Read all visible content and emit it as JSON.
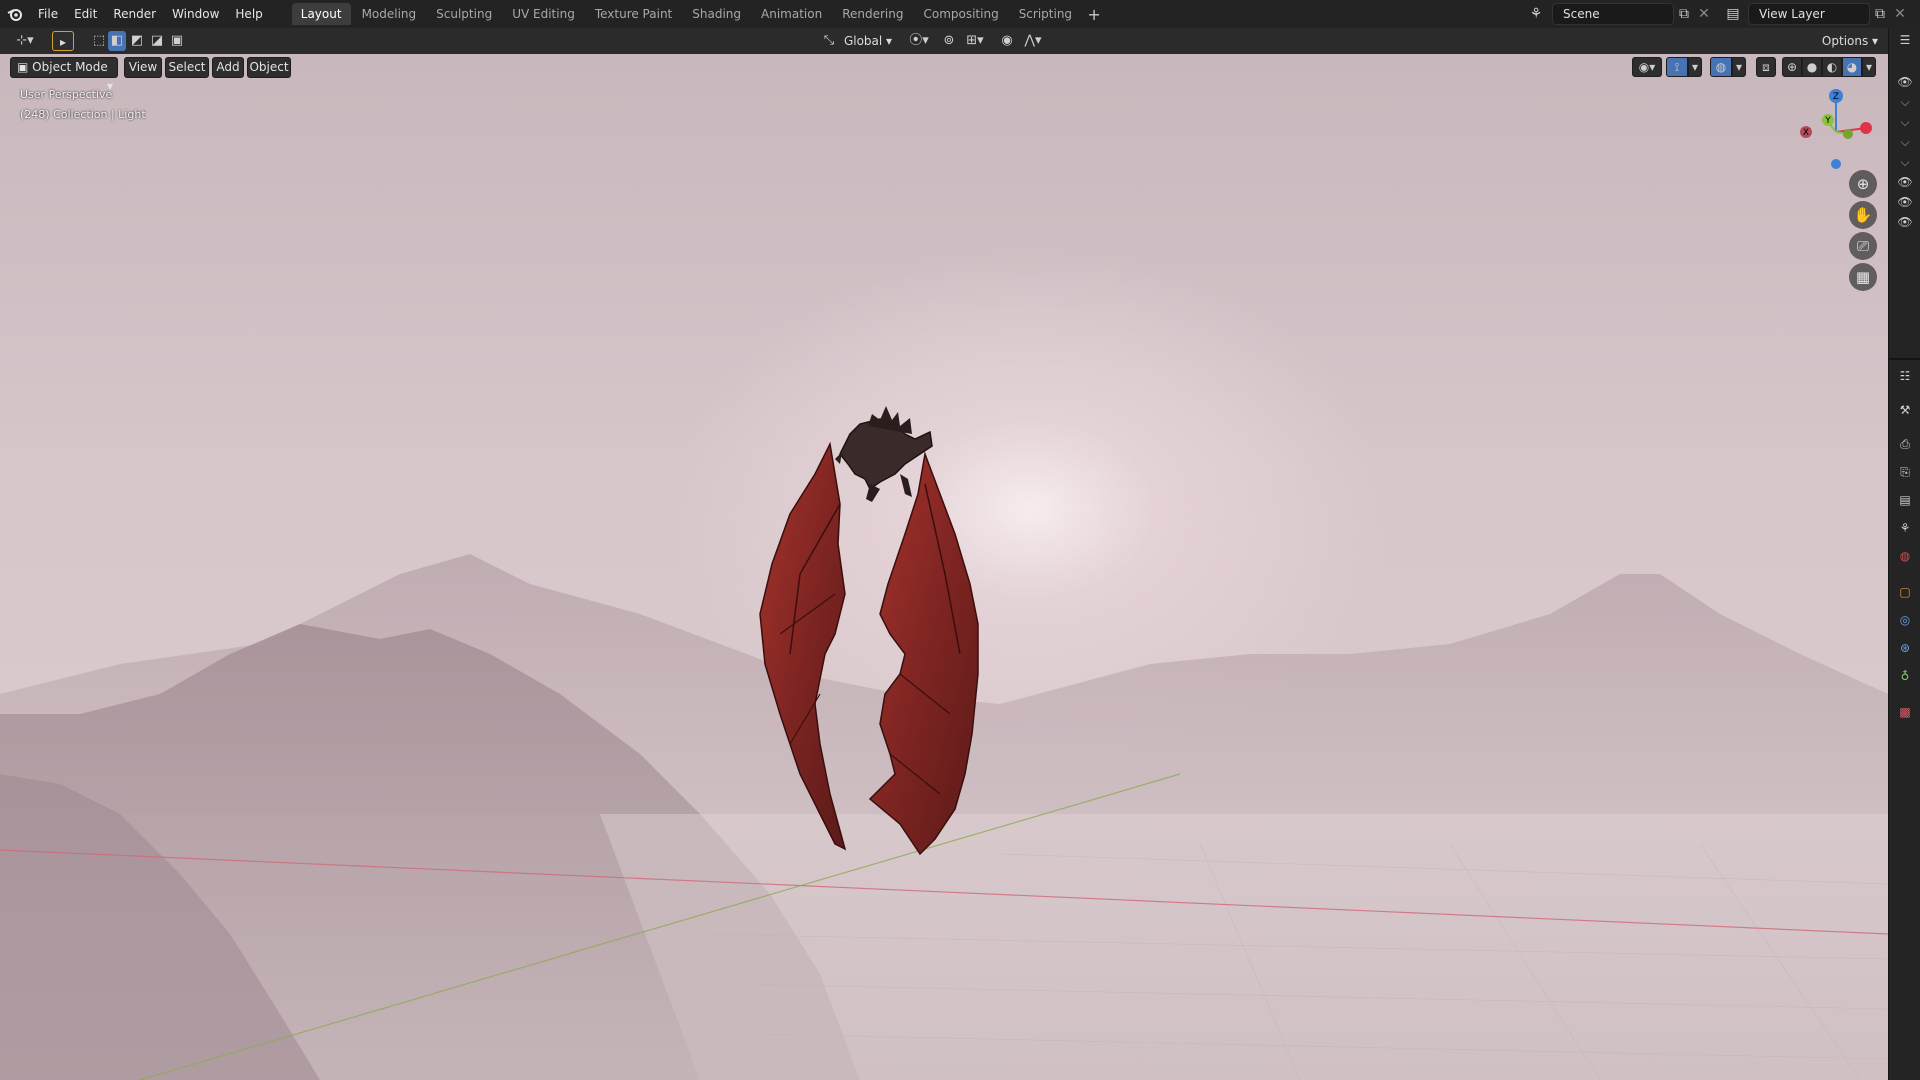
{
  "menu": [
    "File",
    "Edit",
    "Render",
    "Window",
    "Help"
  ],
  "workspaces": [
    "Layout",
    "Modeling",
    "Sculpting",
    "UV Editing",
    "Texture Paint",
    "Shading",
    "Animation",
    "Rendering",
    "Compositing",
    "Scripting"
  ],
  "active_workspace": "Layout",
  "scene": {
    "name": "Scene",
    "view_layer": "View Layer"
  },
  "header": {
    "mode": "Object Mode",
    "menus": [
      "View",
      "Select",
      "Add",
      "Object"
    ],
    "orientation": "Global",
    "options": "Options"
  },
  "viewport": {
    "perspective_label": "User Perspective",
    "collection_label": "(248) Collection | Light"
  },
  "gizmo": {
    "x": "X",
    "y": "Y",
    "z": "Z"
  },
  "icons": {
    "blender_logo": "blender-logo-icon",
    "zoom": "magnifier-icon",
    "pan": "hand-icon",
    "camera": "camera-icon",
    "ortho": "grid-icon"
  },
  "colors": {
    "accent": "#4772b3",
    "axis_x": "#e0344a",
    "axis_y": "#8ac33c",
    "axis_z": "#3d80d8",
    "dragon_wing": "#8e2a26"
  }
}
